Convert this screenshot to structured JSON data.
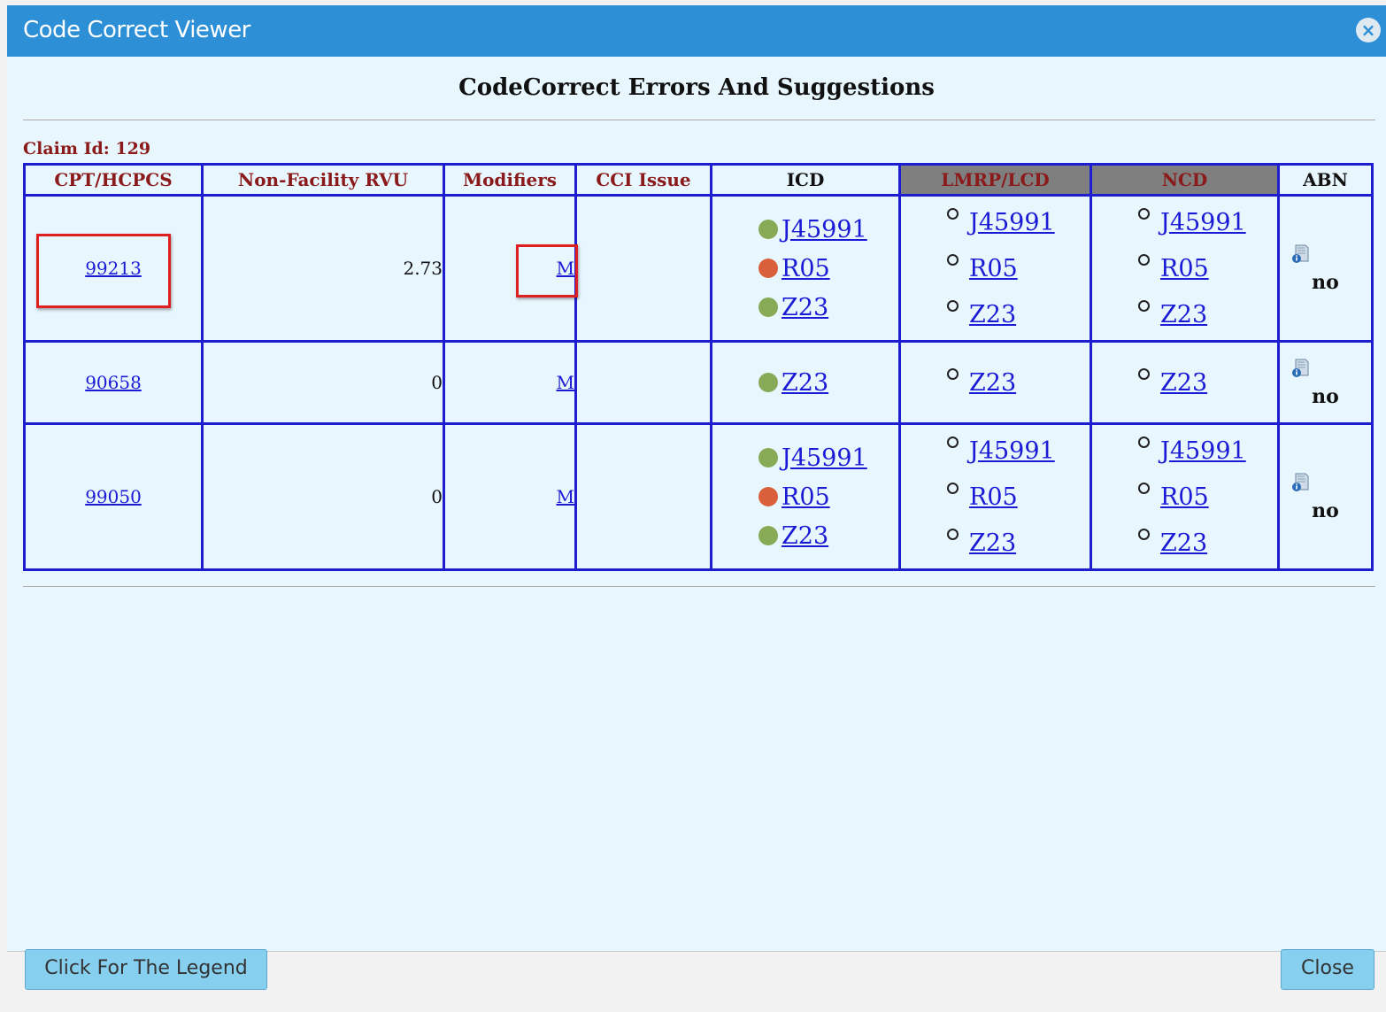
{
  "window": {
    "title": "Code Correct Viewer",
    "close_glyph": "×"
  },
  "heading": "CodeCorrect Errors And Suggestions",
  "claim": {
    "label": "Claim Id: 129"
  },
  "table": {
    "headers": {
      "cpt": "CPT/HCPCS",
      "rvu": "Non-Facility RVU",
      "modifiers": "Modifiers",
      "cci": "CCI Issue",
      "icd": "ICD",
      "lmrp": "LMRP/LCD",
      "ncd": "NCD",
      "abn": "ABN"
    },
    "rows": [
      {
        "cpt": "99213",
        "rvu": "2.73",
        "modifier": "M",
        "cci": "",
        "icd": [
          {
            "code": "J45991",
            "status": "green"
          },
          {
            "code": "R05",
            "status": "red"
          },
          {
            "code": "Z23",
            "status": "green"
          }
        ],
        "lmrp": [
          "J45991",
          "R05",
          "Z23"
        ],
        "ncd": [
          "J45991",
          "R05",
          "Z23"
        ],
        "abn": "no"
      },
      {
        "cpt": "90658",
        "rvu": "0",
        "modifier": "M",
        "cci": "",
        "icd": [
          {
            "code": "Z23",
            "status": "green"
          }
        ],
        "lmrp": [
          "Z23"
        ],
        "ncd": [
          "Z23"
        ],
        "abn": "no"
      },
      {
        "cpt": "99050",
        "rvu": "0",
        "modifier": "M",
        "cci": "",
        "icd": [
          {
            "code": "J45991",
            "status": "green"
          },
          {
            "code": "R05",
            "status": "red"
          },
          {
            "code": "Z23",
            "status": "green"
          }
        ],
        "lmrp": [
          "J45991",
          "R05",
          "Z23"
        ],
        "ncd": [
          "J45991",
          "R05",
          "Z23"
        ],
        "abn": "no"
      }
    ]
  },
  "buttons": {
    "legend": "Click For The Legend",
    "close": "Close"
  },
  "colors": {
    "titlebar": "#2d8fd6",
    "content_bg": "#e8f6fd",
    "table_border": "#1e1ed0",
    "header_text": "#8b1a1a",
    "link": "#1b1bd6",
    "dot_green": "#86aa55",
    "dot_red": "#d9603b",
    "highlight": "#e02020",
    "button_bg": "#87cfee"
  }
}
